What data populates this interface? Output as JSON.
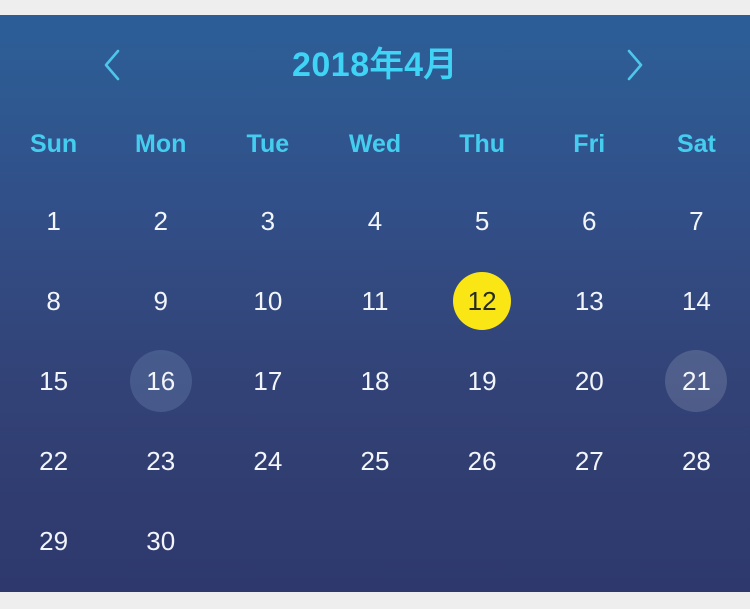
{
  "header": {
    "title": "2018年4月",
    "prev_label": "‹",
    "next_label": "›",
    "title_color": "#3fd3f5"
  },
  "weekdays": [
    {
      "label": "Sun"
    },
    {
      "label": "Mon"
    },
    {
      "label": "Tue"
    },
    {
      "label": "Wed"
    },
    {
      "label": "Thu"
    },
    {
      "label": "Fri"
    },
    {
      "label": "Sat"
    }
  ],
  "colors": {
    "panel_top": "#2d5d96",
    "panel_bottom": "#2e386c",
    "weekday_text": "#45cdef",
    "date_text": "#f2f5fa",
    "today_fill": "#fae615",
    "today_text": "#262b20",
    "page_background": "#eeeeee"
  },
  "weeks": [
    {
      "days": [
        {
          "label": "1",
          "state": "normal"
        },
        {
          "label": "2",
          "state": "normal"
        },
        {
          "label": "3",
          "state": "normal"
        },
        {
          "label": "4",
          "state": "normal"
        },
        {
          "label": "5",
          "state": "normal"
        },
        {
          "label": "6",
          "state": "normal"
        },
        {
          "label": "7",
          "state": "normal"
        }
      ]
    },
    {
      "days": [
        {
          "label": "8",
          "state": "normal"
        },
        {
          "label": "9",
          "state": "normal"
        },
        {
          "label": "10",
          "state": "normal"
        },
        {
          "label": "11",
          "state": "normal"
        },
        {
          "label": "12",
          "state": "today"
        },
        {
          "label": "13",
          "state": "normal"
        },
        {
          "label": "14",
          "state": "normal"
        }
      ]
    },
    {
      "days": [
        {
          "label": "15",
          "state": "normal"
        },
        {
          "label": "16",
          "state": "marked"
        },
        {
          "label": "17",
          "state": "normal"
        },
        {
          "label": "18",
          "state": "normal"
        },
        {
          "label": "19",
          "state": "normal"
        },
        {
          "label": "20",
          "state": "normal"
        },
        {
          "label": "21",
          "state": "marked-alt"
        }
      ]
    },
    {
      "days": [
        {
          "label": "22",
          "state": "normal"
        },
        {
          "label": "23",
          "state": "normal"
        },
        {
          "label": "24",
          "state": "normal"
        },
        {
          "label": "25",
          "state": "normal"
        },
        {
          "label": "26",
          "state": "normal"
        },
        {
          "label": "27",
          "state": "normal"
        },
        {
          "label": "28",
          "state": "normal"
        }
      ]
    },
    {
      "days": [
        {
          "label": "29",
          "state": "normal"
        },
        {
          "label": "30",
          "state": "normal"
        },
        {
          "label": "",
          "state": "empty"
        },
        {
          "label": "",
          "state": "empty"
        },
        {
          "label": "",
          "state": "empty"
        },
        {
          "label": "",
          "state": "empty"
        },
        {
          "label": "",
          "state": "empty"
        }
      ]
    }
  ]
}
